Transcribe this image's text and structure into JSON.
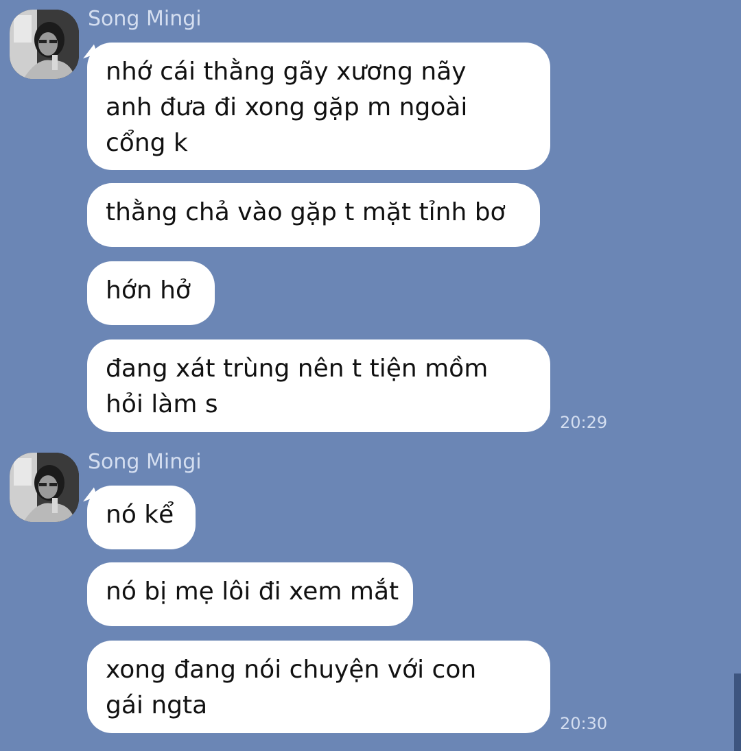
{
  "groups": [
    {
      "sender": "Song Mingi",
      "avatar_icon": "profile-photo",
      "time": "20:29",
      "messages": [
        {
          "lines": [
            "nhớ cái thằng gãy xương nãy",
            "anh đưa đi xong gặp m ngoài",
            "cổng k"
          ]
        },
        {
          "lines": [
            "thằng chả vào gặp t mặt tỉnh bơ"
          ]
        },
        {
          "lines": [
            "hớn hở"
          ]
        },
        {
          "lines": [
            "đang xát trùng nên t tiện mồm",
            "hỏi làm s"
          ]
        }
      ]
    },
    {
      "sender": "Song Mingi",
      "avatar_icon": "profile-photo",
      "time": "20:30",
      "messages": [
        {
          "lines": [
            "nó kể"
          ]
        },
        {
          "lines": [
            "nó bị mẹ lôi đi xem mắt"
          ]
        },
        {
          "lines": [
            "xong đang nói chuyện với con",
            "gái ngta"
          ]
        }
      ]
    }
  ],
  "colors": {
    "background": "#6b86b5",
    "bubble": "#ffffff",
    "meta_text": "#d4def0",
    "scrollbar": "#3d557f"
  }
}
